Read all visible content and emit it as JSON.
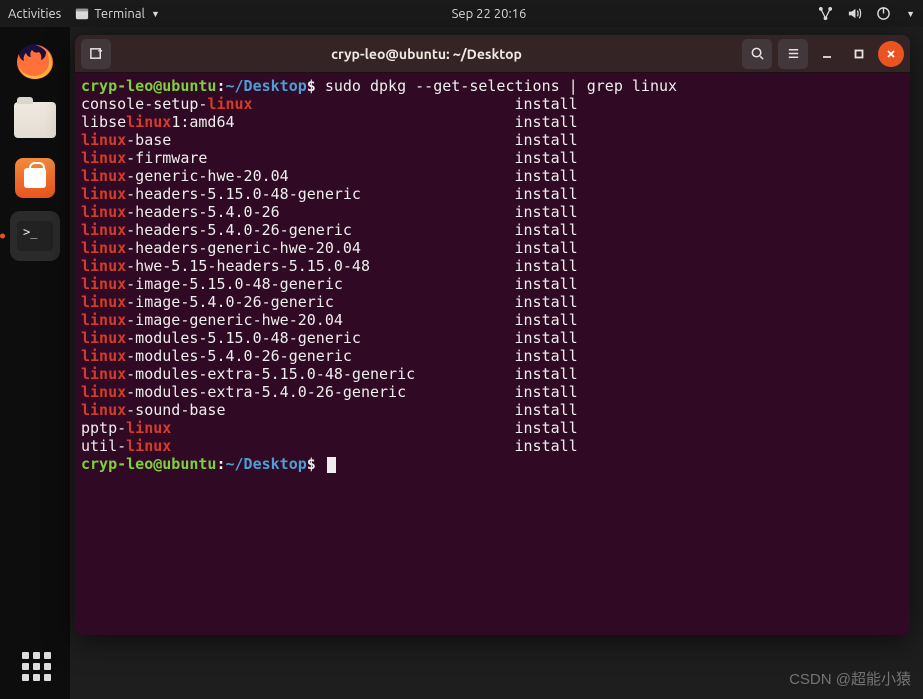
{
  "topbar": {
    "activities": "Activities",
    "terminal_label": "Terminal",
    "clock": "Sep 22  20:16"
  },
  "dock": {
    "firefox_name": "firefox-icon",
    "files_name": "files-icon",
    "software_name": "ubuntu-software-icon",
    "terminal_name": "terminal-icon",
    "apps_name": "show-applications-icon"
  },
  "window": {
    "title": "cryp-leo@ubuntu: ~/Desktop"
  },
  "prompt": {
    "user_host": "cryp-leo@ubuntu",
    "colon": ":",
    "path": "~/Desktop",
    "dollar": "$"
  },
  "command": {
    "text_before_match": "sudo dpkg --get-selections | grep ",
    "match": "linux"
  },
  "lines": [
    {
      "pre": "console-setup-",
      "hl": "linux",
      "post": "",
      "status": "install"
    },
    {
      "pre": "libse",
      "hl": "linux",
      "post": "1:amd64",
      "status": "install"
    },
    {
      "pre": "",
      "hl": "linux",
      "post": "-base",
      "status": "install"
    },
    {
      "pre": "",
      "hl": "linux",
      "post": "-firmware",
      "status": "install"
    },
    {
      "pre": "",
      "hl": "linux",
      "post": "-generic-hwe-20.04",
      "status": "install"
    },
    {
      "pre": "",
      "hl": "linux",
      "post": "-headers-5.15.0-48-generic",
      "status": "install"
    },
    {
      "pre": "",
      "hl": "linux",
      "post": "-headers-5.4.0-26",
      "status": "install"
    },
    {
      "pre": "",
      "hl": "linux",
      "post": "-headers-5.4.0-26-generic",
      "status": "install"
    },
    {
      "pre": "",
      "hl": "linux",
      "post": "-headers-generic-hwe-20.04",
      "status": "install"
    },
    {
      "pre": "",
      "hl": "linux",
      "post": "-hwe-5.15-headers-5.15.0-48",
      "status": "install"
    },
    {
      "pre": "",
      "hl": "linux",
      "post": "-image-5.15.0-48-generic",
      "status": "install"
    },
    {
      "pre": "",
      "hl": "linux",
      "post": "-image-5.4.0-26-generic",
      "status": "install"
    },
    {
      "pre": "",
      "hl": "linux",
      "post": "-image-generic-hwe-20.04",
      "status": "install"
    },
    {
      "pre": "",
      "hl": "linux",
      "post": "-modules-5.15.0-48-generic",
      "status": "install"
    },
    {
      "pre": "",
      "hl": "linux",
      "post": "-modules-5.4.0-26-generic",
      "status": "install"
    },
    {
      "pre": "",
      "hl": "linux",
      "post": "-modules-extra-5.15.0-48-generic",
      "status": "install"
    },
    {
      "pre": "",
      "hl": "linux",
      "post": "-modules-extra-5.4.0-26-generic",
      "status": "install"
    },
    {
      "pre": "",
      "hl": "linux",
      "post": "-sound-base",
      "status": "install"
    },
    {
      "pre": "pptp-",
      "hl": "linux",
      "post": "",
      "status": "install"
    },
    {
      "pre": "util-",
      "hl": "linux",
      "post": "",
      "status": "install"
    }
  ],
  "layout": {
    "status_col": 48
  },
  "watermark": "CSDN @超能小猿"
}
